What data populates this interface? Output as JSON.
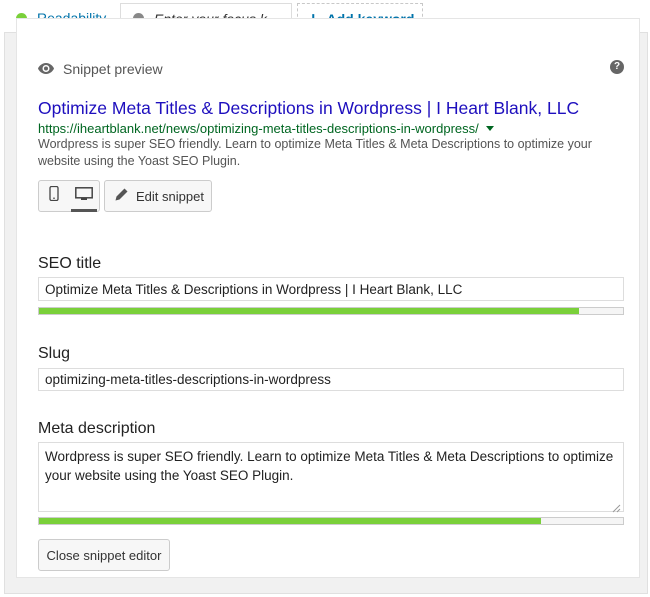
{
  "tabs": {
    "readability": {
      "label": "Readability",
      "dot_color": "#7ad03a"
    },
    "focus": {
      "label": "Enter your focus k…",
      "dot_color": "#888888"
    },
    "add": {
      "label": "Add keyword"
    }
  },
  "snippet": {
    "header": "Snippet preview",
    "title": "Optimize Meta Titles & Descriptions in Wordpress | I Heart Blank, LLC",
    "url": "https://iheartblank.net/news/optimizing-meta-titles-descriptions-in-wordpress/",
    "description": "Wordpress is super SEO friendly. Learn to optimize Meta Titles & Meta Descriptions to optimize your website using the Yoast SEO Plugin.",
    "edit_label": "Edit snippet",
    "devices": [
      "mobile-icon",
      "desktop-icon"
    ],
    "active_device": "desktop"
  },
  "editor": {
    "seo_title": {
      "label": "SEO title",
      "value": "Optimize Meta Titles & Descriptions in Wordpress | I Heart Blank, LLC",
      "progress": 0.925
    },
    "slug": {
      "label": "Slug",
      "value": "optimizing-meta-titles-descriptions-in-wordpress"
    },
    "meta_description": {
      "label": "Meta description",
      "value": "Wordpress is super SEO friendly. Learn to optimize Meta Titles & Meta Descriptions to optimize your website using the Yoast SEO Plugin.",
      "progress": 0.86
    },
    "close_label": "Close snippet editor"
  },
  "colors": {
    "progress_good": "#7ad03a",
    "link_blue": "#1e0fbe",
    "url_green": "#006621",
    "tab_blue": "#0073aa"
  }
}
